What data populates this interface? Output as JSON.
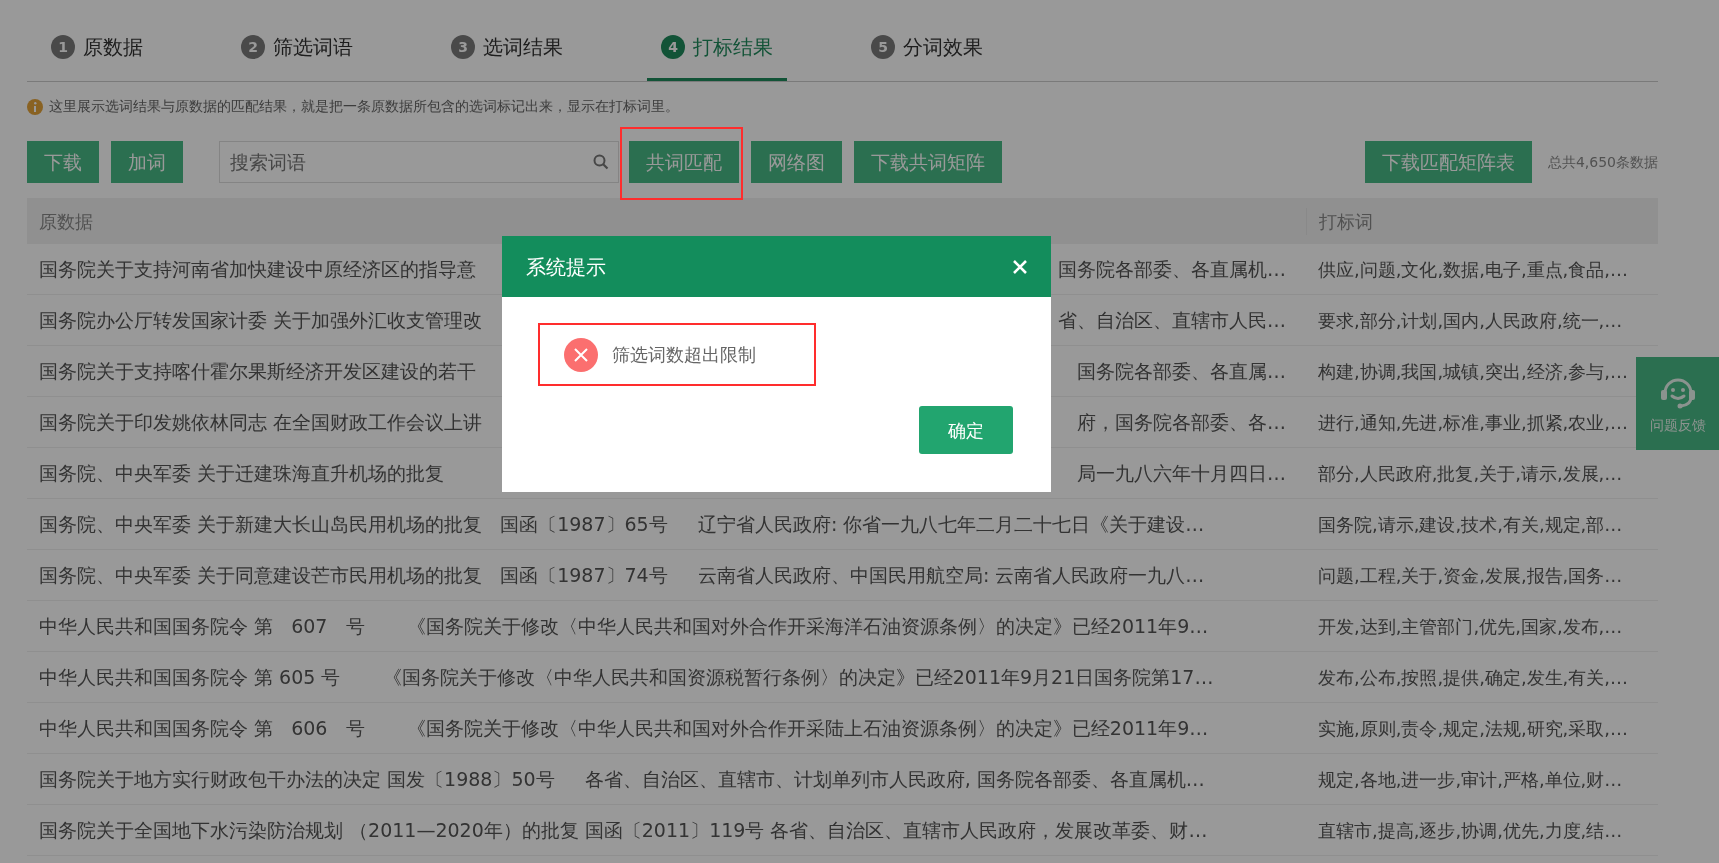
{
  "tabs": [
    {
      "number": "1",
      "label": "原数据",
      "selected": false
    },
    {
      "number": "2",
      "label": "筛选词语",
      "selected": false
    },
    {
      "number": "3",
      "label": "选词结果",
      "selected": false
    },
    {
      "number": "4",
      "label": "打标结果",
      "selected": true
    },
    {
      "number": "5",
      "label": "分词效果",
      "selected": false
    }
  ],
  "notice": "这里展示选词结果与原数据的匹配结果，就是把一条原数据所包含的选词标记出来，显示在打标词里。",
  "toolbar": {
    "left_buttons": [
      {
        "label": "下载",
        "highlighted": false
      },
      {
        "label": "加词",
        "highlighted": false
      }
    ],
    "search": {
      "placeholder": "搜索词语"
    },
    "middle_buttons": [
      {
        "label": "共词匹配",
        "highlighted": true
      },
      {
        "label": "网络图",
        "highlighted": false
      },
      {
        "label": "下载共词矩阵",
        "highlighted": false
      }
    ],
    "right_buttons": [
      {
        "label": "下载匹配矩阵表",
        "highlighted": false
      }
    ],
    "total": "总共4,650条数据"
  },
  "table": {
    "columns": [
      "原数据",
      "打标词"
    ],
    "rows": [
      {
        "kind": "covered",
        "shown_start": "国务院关于支持河南省加快建设中原经济区的指导意",
        "shown_end": "国务院各部委、各直属机…",
        "tags": "供应,问题,文化,数据,电子,重点,食品,…"
      },
      {
        "kind": "covered",
        "shown_start": "国务院办公厅转发国家计委 关于加强外汇收支管理改",
        "shown_end": "省、自治区、直辖市人民…",
        "tags": "要求,部分,计划,国内,人民政府,统一,…"
      },
      {
        "kind": "covered",
        "shown_start": "国务院关于支持喀什霍尔果斯经济开发区建设的若干",
        "shown_end": "国务院各部委、各直属…",
        "tags": "构建,协调,我国,城镇,突出,经济,参与,…"
      },
      {
        "kind": "covered",
        "shown_start": "国务院关于印发姚依林同志 在全国财政工作会议上讲",
        "shown_end": "府，国务院各部委、各…",
        "tags": "进行,通知,先进,标准,事业,抓紧,农业,…"
      },
      {
        "kind": "covered",
        "shown_start": "国务院、中央军委 关于迁建珠海直升机场的批复",
        "shown_end": "局一九八六年十月四日…",
        "tags": "部分,人民政府,批复,关于,请示,发展,…"
      },
      {
        "kind": "full",
        "original": "国务院、中央军委 关于新建大长山岛民用机场的批复   国函〔1987〕65号     辽宁省人民政府: 你省一九八七年二月二十七日《关于建设…",
        "tags": "国务院,请示,建设,技术,有关,规定,部…"
      },
      {
        "kind": "full",
        "original": "国务院、中央军委 关于同意建设芒市民用机场的批复   国函〔1987〕74号     云南省人民政府、中国民用航空局: 云南省人民政府一九八…",
        "tags": "问题,工程,关于,资金,发展,报告,国务…"
      },
      {
        "kind": "full",
        "original": "中华人民共和国国务院令 第   607   号       《国务院关于修改〈中华人民共和国对外合作开采海洋石油资源条例〉的决定》已经2011年9…",
        "tags": "开发,达到,主管部门,优先,国家,发布,…"
      },
      {
        "kind": "full",
        "original": "中华人民共和国国务院令 第 605 号       《国务院关于修改〈中华人民共和国资源税暂行条例〉的决定》已经2011年9月21日国务院第17…",
        "tags": "发布,公布,按照,提供,确定,发生,有关,…"
      },
      {
        "kind": "full",
        "original": "中华人民共和国国务院令 第   606   号       《国务院关于修改〈中华人民共和国对外合作开采陆上石油资源条例〉的决定》已经2011年9…",
        "tags": "实施,原则,责令,规定,法规,研究,采取,…"
      },
      {
        "kind": "full",
        "original": "国务院关于地方实行财政包干办法的决定 国发〔1988〕50号     各省、自治区、直辖市、计划单列市人民政府, 国务院各部委、各直属机…",
        "tags": "规定,各地,进一步,审计,严格,单位,财…"
      },
      {
        "kind": "full",
        "original": "国务院关于全国地下水污染防治规划 （2011—2020年）的批复 国函〔2011〕119号 各省、自治区、直辖市人民政府，发展改革委、财…",
        "tags": "直辖市,提高,逐步,协调,优先,力度,结…"
      }
    ]
  },
  "feedback": {
    "label": "问题反馈"
  },
  "dialog": {
    "title": "系统提示",
    "message": "筛选词数超出限制",
    "message_highlighted": true,
    "confirm": "确定"
  }
}
